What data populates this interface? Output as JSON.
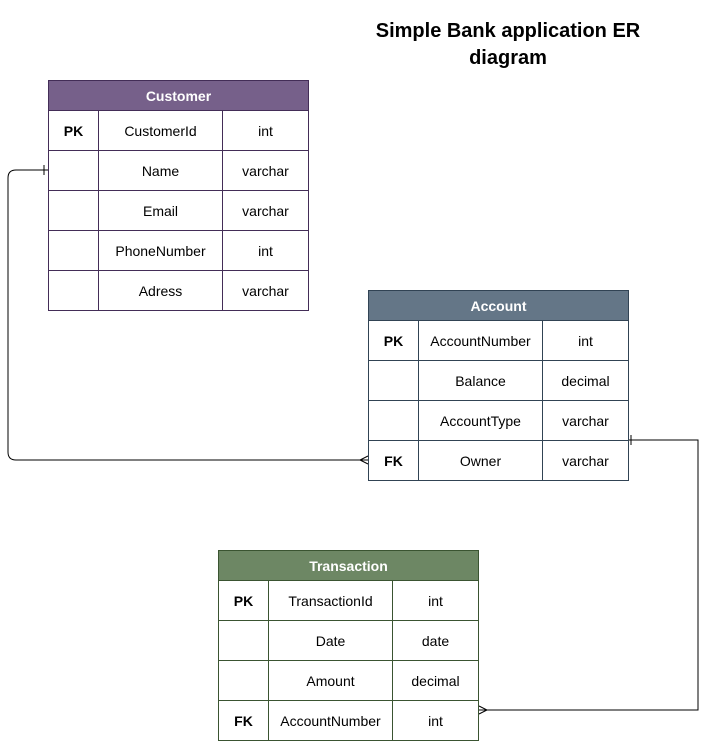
{
  "title": {
    "line1": "Simple Bank application ER",
    "line2": "diagram"
  },
  "entities": {
    "customer": {
      "name": "Customer",
      "header_color": "#76608A",
      "border_color": "#432D57",
      "rows": [
        {
          "key": "PK",
          "name": "CustomerId",
          "type": "int"
        },
        {
          "key": "",
          "name": "Name",
          "type": "varchar"
        },
        {
          "key": "",
          "name": "Email",
          "type": "varchar"
        },
        {
          "key": "",
          "name": "PhoneNumber",
          "type": "int"
        },
        {
          "key": "",
          "name": "Adress",
          "type": "varchar"
        }
      ]
    },
    "account": {
      "name": "Account",
      "header_color": "#647687",
      "border_color": "#314354",
      "rows": [
        {
          "key": "PK",
          "name": "AccountNumber",
          "type": "int"
        },
        {
          "key": "",
          "name": "Balance",
          "type": "decimal"
        },
        {
          "key": "",
          "name": "AccountType",
          "type": "varchar"
        },
        {
          "key": "FK",
          "name": "Owner",
          "type": "varchar"
        }
      ]
    },
    "transaction": {
      "name": "Transaction",
      "header_color": "#6D8764",
      "border_color": "#3A5431",
      "rows": [
        {
          "key": "PK",
          "name": "TransactionId",
          "type": "int"
        },
        {
          "key": "",
          "name": "Date",
          "type": "date"
        },
        {
          "key": "",
          "name": "Amount",
          "type": "decimal"
        },
        {
          "key": "FK",
          "name": "AccountNumber",
          "type": "int"
        }
      ]
    }
  },
  "relationships": [
    {
      "from": "customer.Name",
      "to": "account.Owner",
      "from_end": "one",
      "to_end": "many"
    },
    {
      "from": "account.AccountType",
      "to": "transaction.AccountNumber",
      "from_end": "one",
      "to_end": "many"
    }
  ]
}
